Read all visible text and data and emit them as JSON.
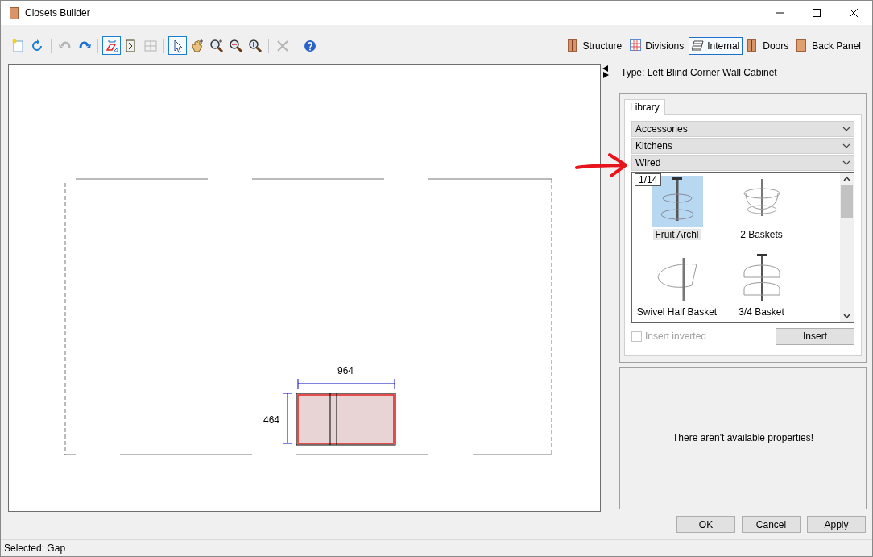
{
  "window": {
    "title": "Closets Builder"
  },
  "toolbar": [
    {
      "kind": "new",
      "disabled": false,
      "selected": false
    },
    {
      "kind": "refresh",
      "disabled": false,
      "selected": false
    },
    {
      "kind": "sep"
    },
    {
      "kind": "undo",
      "disabled": true,
      "selected": false
    },
    {
      "kind": "redo",
      "disabled": false,
      "selected": false
    },
    {
      "kind": "sep"
    },
    {
      "kind": "shape",
      "disabled": false,
      "selected": true
    },
    {
      "kind": "bracket",
      "disabled": false,
      "selected": false
    },
    {
      "kind": "grid",
      "disabled": true,
      "selected": false
    },
    {
      "kind": "sep"
    },
    {
      "kind": "pointer",
      "disabled": false,
      "selected": true
    },
    {
      "kind": "pan",
      "disabled": false,
      "selected": false
    },
    {
      "kind": "zoom",
      "disabled": false,
      "selected": false
    },
    {
      "kind": "zoomfit",
      "disabled": false,
      "selected": false
    },
    {
      "kind": "zoomheight",
      "disabled": false,
      "selected": false
    },
    {
      "kind": "sep"
    },
    {
      "kind": "delete",
      "disabled": true,
      "selected": false
    },
    {
      "kind": "sep"
    },
    {
      "kind": "help",
      "disabled": false,
      "selected": false
    }
  ],
  "modes": [
    {
      "label": "Structure",
      "kind": "cabinet",
      "selected": false
    },
    {
      "label": "Divisions",
      "kind": "grid",
      "selected": false
    },
    {
      "label": "Internal",
      "kind": "shelves",
      "selected": true
    },
    {
      "label": "Doors",
      "kind": "cabinet",
      "selected": false
    },
    {
      "label": "Back Panel",
      "kind": "panel",
      "selected": false
    }
  ],
  "type_label": "Type: Left Blind Corner Wall Cabinet",
  "drawing": {
    "width_dim": "964",
    "height_dim": "464"
  },
  "library": {
    "tab": {
      "label": "Library"
    },
    "categories": [
      {
        "label": "Accessories"
      },
      {
        "label": "Kitchens"
      },
      {
        "label": "Wired"
      }
    ],
    "counter": "1/14",
    "items": [
      {
        "label": "Fruit Archl",
        "selected": true
      },
      {
        "label": "2 Baskets",
        "selected": false
      },
      {
        "label": "Swivel Half Basket",
        "selected": false
      },
      {
        "label": "3/4 Basket",
        "selected": false
      }
    ],
    "insert_inverted": {
      "label": "Insert inverted",
      "checked": false,
      "disabled": true
    },
    "insert_button": "Insert"
  },
  "properties": {
    "message": "There aren't available properties!"
  },
  "buttons": [
    "OK",
    "Cancel",
    "Apply"
  ],
  "status_bar": "Selected: Gap"
}
